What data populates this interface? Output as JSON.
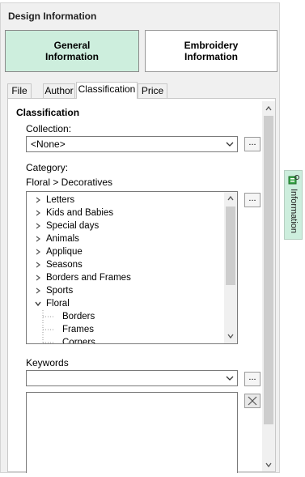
{
  "panel": {
    "title": "Design Information",
    "mode_buttons": {
      "general": "General\nInformation",
      "embroidery": "Embroidery\nInformation"
    },
    "tabs": [
      {
        "label": "File",
        "active": false
      },
      {
        "label": "Author",
        "active": false
      },
      {
        "label": "Classification",
        "active": true
      },
      {
        "label": "Price",
        "active": false
      }
    ]
  },
  "classification": {
    "section_title": "Classification",
    "collection_label": "Collection:",
    "collection_value": "<None>",
    "collection_button": "...",
    "category_label": "Category:",
    "category_path": "Floral > Decoratives",
    "category_button": "...",
    "tree": [
      {
        "label": "Letters",
        "expanded": false
      },
      {
        "label": "Kids and Babies",
        "expanded": false
      },
      {
        "label": "Special days",
        "expanded": false
      },
      {
        "label": "Animals",
        "expanded": false
      },
      {
        "label": "Applique",
        "expanded": false
      },
      {
        "label": "Seasons",
        "expanded": false
      },
      {
        "label": "Borders and Frames",
        "expanded": false
      },
      {
        "label": "Sports",
        "expanded": false
      },
      {
        "label": "Floral",
        "expanded": true
      }
    ],
    "tree_children": [
      "Borders",
      "Frames",
      "Corners"
    ],
    "keywords_label": "Keywords",
    "keywords_value": "",
    "keywords_button": "..."
  },
  "side_tab": {
    "label": "Information",
    "icon": "info-panel-icon"
  },
  "colors": {
    "accent_green": "#cdeedd"
  }
}
